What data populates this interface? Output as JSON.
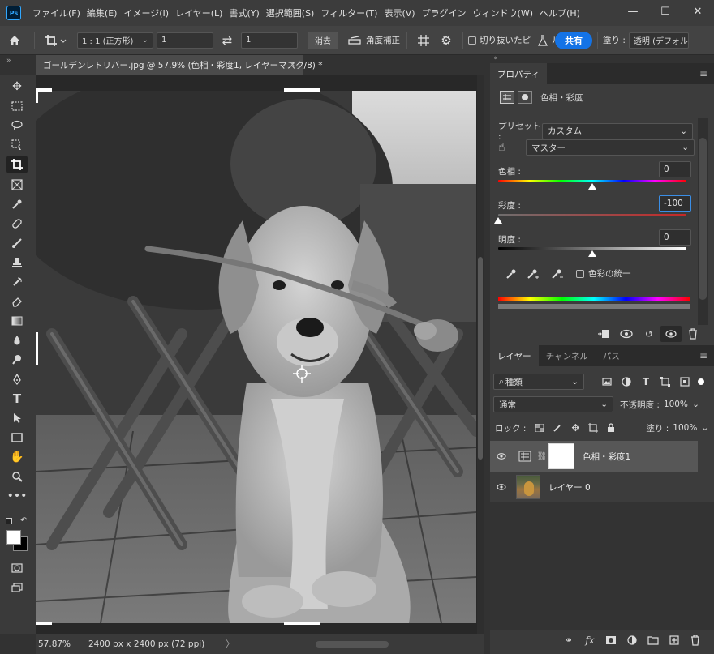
{
  "app": {
    "logo": "Ps"
  },
  "menu": [
    "ファイル(F)",
    "編集(E)",
    "イメージ(I)",
    "レイヤー(L)",
    "書式(Y)",
    "選択範囲(S)",
    "フィルター(T)",
    "表示(V)",
    "プラグイン",
    "ウィンドウ(W)",
    "ヘルプ(H)"
  ],
  "window_controls": {
    "minimize": "—",
    "maximize": "☐",
    "close": "✕"
  },
  "options": {
    "ratio_label": "1 : 1 (正方形)",
    "width_value": "1",
    "height_value": "1",
    "clear_label": "消去",
    "straighten_label": "角度補正",
    "delete_cropped_label": "切り抜いたピ",
    "partial_label": "ル",
    "share_label": "共有",
    "fill_label": "塗り :",
    "fill_value": "透明 (デフォル"
  },
  "document": {
    "tab_title": "ゴールデンレトリバー.jpg @ 57.9% (色相・彩度1, レイヤーマスク/8) *",
    "close": "×",
    "zoom": "57.87%",
    "dimensions": "2400 px x 2400 px (72 ppi)",
    "arrow": "〉"
  },
  "properties": {
    "tab_label": "プロパティ",
    "title": "色相・彩度",
    "preset_label": "プリセット :",
    "preset_value": "カスタム",
    "channel_value": "マスター",
    "hue_label": "色相 :",
    "hue_value": "0",
    "hue_fraction": 0.5,
    "saturation_label": "彩度 :",
    "saturation_value": "-100",
    "saturation_fraction": 0.0,
    "lightness_label": "明度 :",
    "lightness_value": "0",
    "lightness_fraction": 0.5,
    "colorize_label": "色彩の統一"
  },
  "layers_panel": {
    "tabs": [
      "レイヤー",
      "チャンネル",
      "パス"
    ],
    "filter_value": "種類",
    "blend_value": "通常",
    "opacity_label": "不透明度 :",
    "opacity_value": "100%",
    "lock_label": "ロック :",
    "fill_label": "塗り :",
    "fill_value": "100%",
    "layers": [
      {
        "name": "色相・彩度1",
        "selected": true
      },
      {
        "name": "レイヤー 0",
        "selected": false
      }
    ]
  },
  "colors": {
    "accent": "#1473e6",
    "menubar": "#3c3c3c",
    "panel": "#3c3c3c",
    "canvas_bg": "#282828"
  }
}
